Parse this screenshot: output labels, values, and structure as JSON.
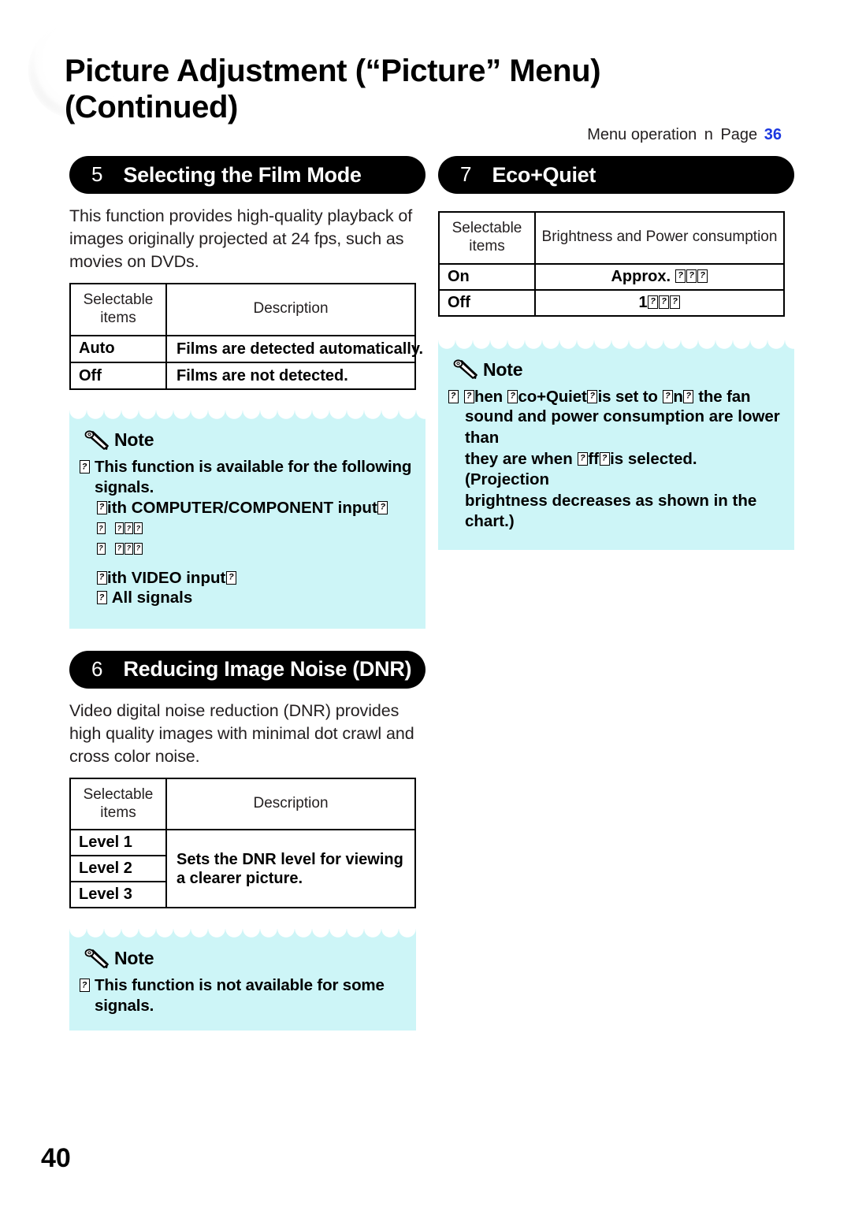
{
  "document": {
    "title_line1": "Picture Adjustment (“Picture” Menu)",
    "title_line2": "(Continued)",
    "folio": "40"
  },
  "menu_operation": {
    "label": "Menu operation",
    "arrow_glyph": "n",
    "page_label": "Page",
    "page_number": "36",
    "page_number_color": "#1b37e0"
  },
  "sections": {
    "film_mode": {
      "number": "5",
      "title": "Selecting the Film Mode",
      "intro": "This function provides high-quality playback of images originally projected at 24 fps, such as movies on DVDs.",
      "table": {
        "headers": [
          "Selectable\nitems",
          "Description"
        ],
        "rows": [
          {
            "item": "Auto",
            "description": "Films are detected automatically."
          },
          {
            "item": "Off",
            "description": "Films are not detected."
          }
        ]
      },
      "note": {
        "label": "Note",
        "bullet": "□",
        "body_line1": "This function is available for the following\nsignals.",
        "sub_computer_label": "ith COMPUTER/COMPONENT input",
        "sub_computer_item1": "",
        "sub_computer_item2": "",
        "sub_video_label": "ith VIDEO input",
        "sub_video_item": "All signals"
      }
    },
    "dnr": {
      "number": "6",
      "title": "Reducing Image Noise (DNR)",
      "intro": "Video digital noise reduction (DNR) provides high quality images with minimal dot crawl and cross color noise.",
      "table": {
        "headers": [
          "Selectable\nitems",
          "Description"
        ],
        "items": [
          "Level 1",
          "Level 2",
          "Level 3"
        ],
        "merged_description": "Sets the DNR level for viewing a clearer picture."
      },
      "note": {
        "label": "Note",
        "body": "This function is not available for some signals."
      }
    },
    "eco_quiet": {
      "number": "7",
      "title": "Eco+Quiet",
      "table": {
        "headers": [
          "Selectable\nitems",
          "Brightness and Power consumption"
        ],
        "rows": [
          {
            "item": "On",
            "description_prefix": "Approx. ",
            "description_tofu": 3
          },
          {
            "item": "Off",
            "description_prefix": "1",
            "description_tofu": 3
          }
        ]
      },
      "note": {
        "label": "Note",
        "line1_a": "hen ",
        "line1_b": "co+Quiet",
        "line1_c": "is set to ",
        "line1_d": "n",
        "line1_e": "the fan",
        "line2": "sound and power consumption are lower than",
        "line3_a": "they are when ",
        "line3_b": "ff",
        "line3_c": "is selected. (Projection",
        "line4": "brightness decreases as shown in the chart.)"
      }
    }
  },
  "colors": {
    "note_background": "#cdf5f7",
    "pill_background": "#000000",
    "accent_blue": "#1b37e0"
  }
}
